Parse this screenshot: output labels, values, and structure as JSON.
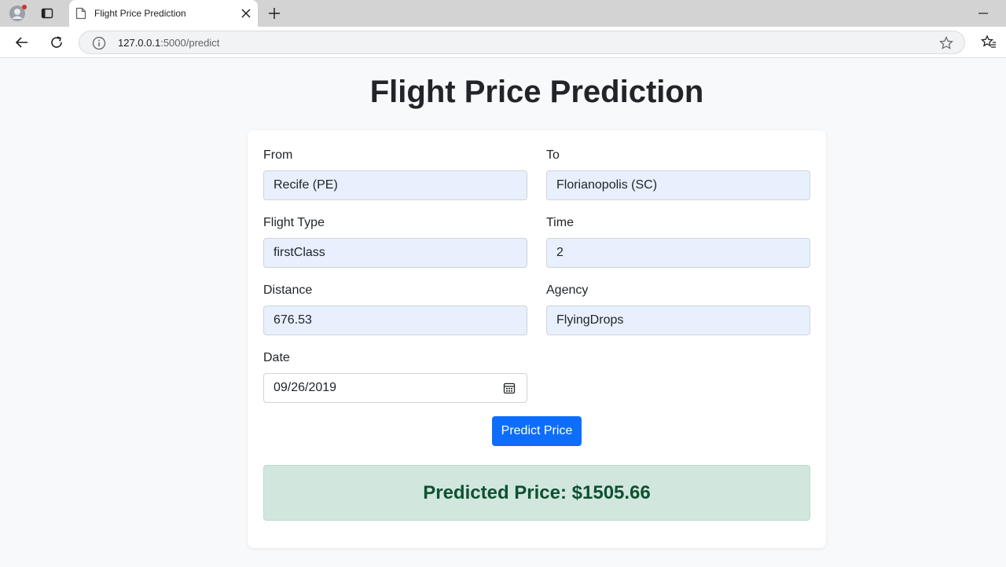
{
  "browser": {
    "tab_title": "Flight Price Prediction",
    "url_host": "127.0.0.1",
    "url_path": ":5000/predict"
  },
  "page": {
    "title": "Flight Price Prediction"
  },
  "form": {
    "from": {
      "label": "From",
      "value": "Recife (PE)"
    },
    "to": {
      "label": "To",
      "value": "Florianopolis (SC)"
    },
    "flight_type": {
      "label": "Flight Type",
      "value": "firstClass"
    },
    "time": {
      "label": "Time",
      "value": "2"
    },
    "distance": {
      "label": "Distance",
      "value": "676.53"
    },
    "agency": {
      "label": "Agency",
      "value": "FlyingDrops"
    },
    "date": {
      "label": "Date",
      "value": "09/26/2019"
    },
    "submit_label": "Predict Price"
  },
  "result": {
    "text": "Predicted Price: $1505.66"
  },
  "colors": {
    "primary": "#0d6efd",
    "success_bg": "#d1e7dd",
    "success_text": "#0f5132",
    "autofill_bg": "#e8f0fe"
  },
  "icons": [
    "profile-icon",
    "tabs-icon",
    "page-icon",
    "close-icon",
    "plus-icon",
    "minimize-icon",
    "back-arrow-icon",
    "reload-icon",
    "info-icon",
    "star-icon",
    "favorites-icon",
    "calendar-icon"
  ]
}
